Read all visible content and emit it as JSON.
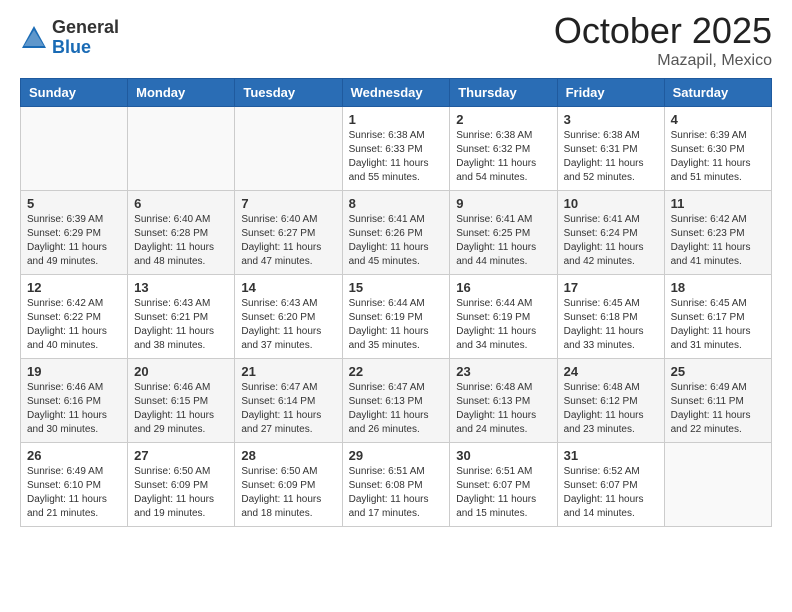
{
  "header": {
    "logo_general": "General",
    "logo_blue": "Blue",
    "month_title": "October 2025",
    "subtitle": "Mazapil, Mexico"
  },
  "days_of_week": [
    "Sunday",
    "Monday",
    "Tuesday",
    "Wednesday",
    "Thursday",
    "Friday",
    "Saturday"
  ],
  "weeks": [
    [
      {
        "day": "",
        "info": ""
      },
      {
        "day": "",
        "info": ""
      },
      {
        "day": "",
        "info": ""
      },
      {
        "day": "1",
        "info": "Sunrise: 6:38 AM\nSunset: 6:33 PM\nDaylight: 11 hours\nand 55 minutes."
      },
      {
        "day": "2",
        "info": "Sunrise: 6:38 AM\nSunset: 6:32 PM\nDaylight: 11 hours\nand 54 minutes."
      },
      {
        "day": "3",
        "info": "Sunrise: 6:38 AM\nSunset: 6:31 PM\nDaylight: 11 hours\nand 52 minutes."
      },
      {
        "day": "4",
        "info": "Sunrise: 6:39 AM\nSunset: 6:30 PM\nDaylight: 11 hours\nand 51 minutes."
      }
    ],
    [
      {
        "day": "5",
        "info": "Sunrise: 6:39 AM\nSunset: 6:29 PM\nDaylight: 11 hours\nand 49 minutes."
      },
      {
        "day": "6",
        "info": "Sunrise: 6:40 AM\nSunset: 6:28 PM\nDaylight: 11 hours\nand 48 minutes."
      },
      {
        "day": "7",
        "info": "Sunrise: 6:40 AM\nSunset: 6:27 PM\nDaylight: 11 hours\nand 47 minutes."
      },
      {
        "day": "8",
        "info": "Sunrise: 6:41 AM\nSunset: 6:26 PM\nDaylight: 11 hours\nand 45 minutes."
      },
      {
        "day": "9",
        "info": "Sunrise: 6:41 AM\nSunset: 6:25 PM\nDaylight: 11 hours\nand 44 minutes."
      },
      {
        "day": "10",
        "info": "Sunrise: 6:41 AM\nSunset: 6:24 PM\nDaylight: 11 hours\nand 42 minutes."
      },
      {
        "day": "11",
        "info": "Sunrise: 6:42 AM\nSunset: 6:23 PM\nDaylight: 11 hours\nand 41 minutes."
      }
    ],
    [
      {
        "day": "12",
        "info": "Sunrise: 6:42 AM\nSunset: 6:22 PM\nDaylight: 11 hours\nand 40 minutes."
      },
      {
        "day": "13",
        "info": "Sunrise: 6:43 AM\nSunset: 6:21 PM\nDaylight: 11 hours\nand 38 minutes."
      },
      {
        "day": "14",
        "info": "Sunrise: 6:43 AM\nSunset: 6:20 PM\nDaylight: 11 hours\nand 37 minutes."
      },
      {
        "day": "15",
        "info": "Sunrise: 6:44 AM\nSunset: 6:19 PM\nDaylight: 11 hours\nand 35 minutes."
      },
      {
        "day": "16",
        "info": "Sunrise: 6:44 AM\nSunset: 6:19 PM\nDaylight: 11 hours\nand 34 minutes."
      },
      {
        "day": "17",
        "info": "Sunrise: 6:45 AM\nSunset: 6:18 PM\nDaylight: 11 hours\nand 33 minutes."
      },
      {
        "day": "18",
        "info": "Sunrise: 6:45 AM\nSunset: 6:17 PM\nDaylight: 11 hours\nand 31 minutes."
      }
    ],
    [
      {
        "day": "19",
        "info": "Sunrise: 6:46 AM\nSunset: 6:16 PM\nDaylight: 11 hours\nand 30 minutes."
      },
      {
        "day": "20",
        "info": "Sunrise: 6:46 AM\nSunset: 6:15 PM\nDaylight: 11 hours\nand 29 minutes."
      },
      {
        "day": "21",
        "info": "Sunrise: 6:47 AM\nSunset: 6:14 PM\nDaylight: 11 hours\nand 27 minutes."
      },
      {
        "day": "22",
        "info": "Sunrise: 6:47 AM\nSunset: 6:13 PM\nDaylight: 11 hours\nand 26 minutes."
      },
      {
        "day": "23",
        "info": "Sunrise: 6:48 AM\nSunset: 6:13 PM\nDaylight: 11 hours\nand 24 minutes."
      },
      {
        "day": "24",
        "info": "Sunrise: 6:48 AM\nSunset: 6:12 PM\nDaylight: 11 hours\nand 23 minutes."
      },
      {
        "day": "25",
        "info": "Sunrise: 6:49 AM\nSunset: 6:11 PM\nDaylight: 11 hours\nand 22 minutes."
      }
    ],
    [
      {
        "day": "26",
        "info": "Sunrise: 6:49 AM\nSunset: 6:10 PM\nDaylight: 11 hours\nand 21 minutes."
      },
      {
        "day": "27",
        "info": "Sunrise: 6:50 AM\nSunset: 6:09 PM\nDaylight: 11 hours\nand 19 minutes."
      },
      {
        "day": "28",
        "info": "Sunrise: 6:50 AM\nSunset: 6:09 PM\nDaylight: 11 hours\nand 18 minutes."
      },
      {
        "day": "29",
        "info": "Sunrise: 6:51 AM\nSunset: 6:08 PM\nDaylight: 11 hours\nand 17 minutes."
      },
      {
        "day": "30",
        "info": "Sunrise: 6:51 AM\nSunset: 6:07 PM\nDaylight: 11 hours\nand 15 minutes."
      },
      {
        "day": "31",
        "info": "Sunrise: 6:52 AM\nSunset: 6:07 PM\nDaylight: 11 hours\nand 14 minutes."
      },
      {
        "day": "",
        "info": ""
      }
    ]
  ]
}
